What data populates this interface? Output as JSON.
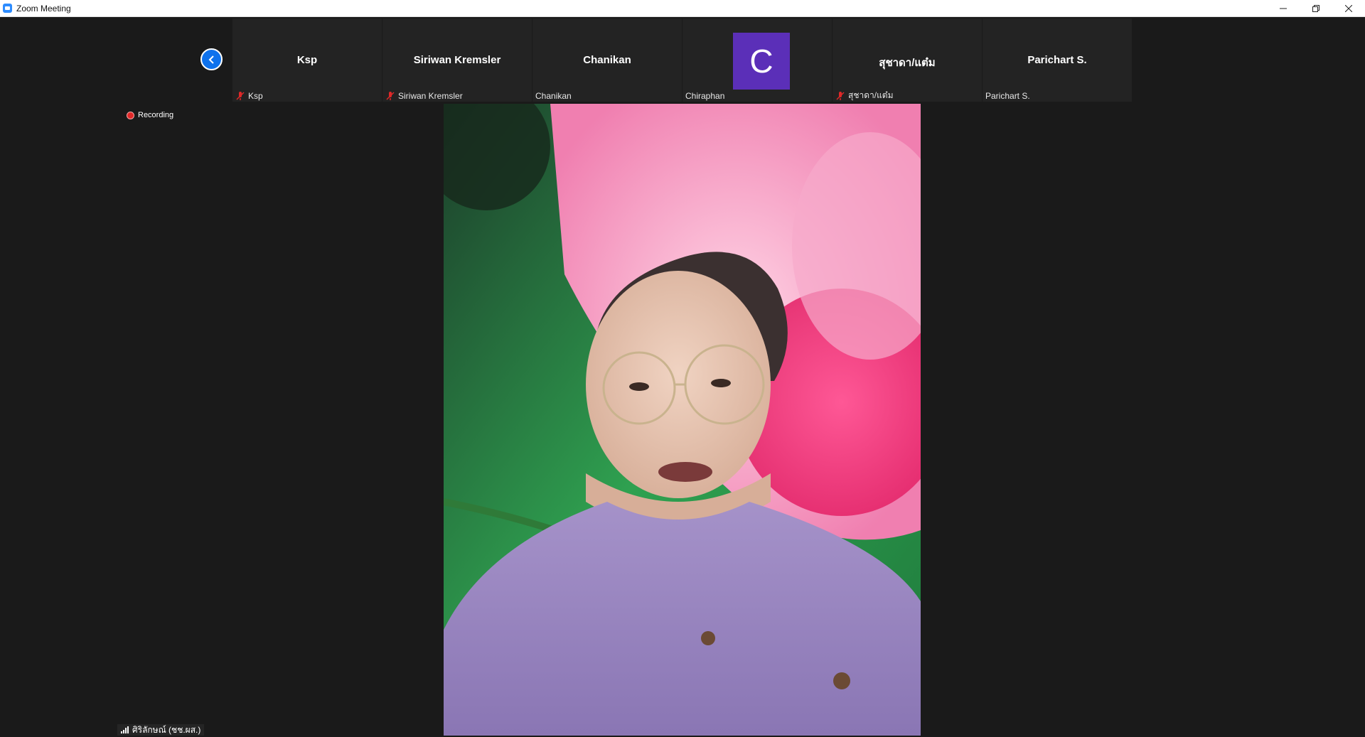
{
  "window": {
    "title": "Zoom Meeting",
    "controls": [
      "minimize-icon",
      "restore-icon",
      "close-icon"
    ]
  },
  "gallery": {
    "participants": [
      {
        "display": "Ksp",
        "label": "Ksp",
        "muted": true,
        "avatar": null
      },
      {
        "display": "Siriwan Kremsler",
        "label": "Siriwan Kremsler",
        "muted": true,
        "avatar": null
      },
      {
        "display": "Chanikan",
        "label": "Chanikan",
        "muted": false,
        "avatar": null
      },
      {
        "display": "",
        "label": "Chiraphan",
        "muted": false,
        "avatar": "C"
      },
      {
        "display": "สุชาดา/แต๋ม",
        "label": "สุชาดา/แต๋ม",
        "muted": true,
        "avatar": null
      },
      {
        "display": "Parichart S.",
        "label": "Parichart S.",
        "muted": false,
        "avatar": null
      }
    ]
  },
  "recording": {
    "label": "Recording"
  },
  "active_speaker": {
    "name": "ศิริลักษณ์ (ชช.ผส.)"
  },
  "colors": {
    "accent": "#0e72ed",
    "avatar_bg": "#5b2fb8",
    "recording": "#e02828",
    "muted": "#e02828",
    "background": "#1a1a1a"
  }
}
